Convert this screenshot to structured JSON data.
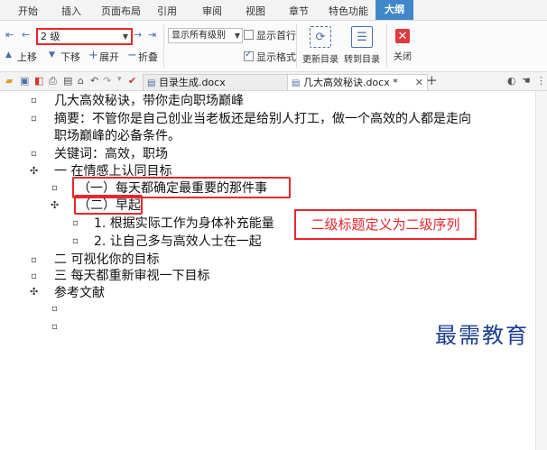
{
  "tabs": [
    "开始",
    "插入",
    "页面布局",
    "引用",
    "审阅",
    "视图",
    "章节",
    "特色功能",
    "大纲"
  ],
  "ribbon": {
    "level_value": "2 级",
    "show_level_value": "显示所有级别",
    "show_first_line_label": "显示首行",
    "show_format_label": "显示格式",
    "move_up_label": "上移",
    "move_down_label": "下移",
    "expand_label": "展开",
    "collapse_label": "折叠",
    "update_toc_label": "更新目录",
    "goto_toc_label": "转到目录",
    "close_label": "关闭"
  },
  "doc_tabs": [
    {
      "label": "目录生成.docx"
    },
    {
      "label": "几大高效秘诀.docx *"
    }
  ],
  "outline": [
    {
      "text": "几大高效秘诀，带你走向职场巅峰"
    },
    {
      "text": "摘要：不管你是自己创业当老板还是给别人打工，做一个高效的人都是走向"
    },
    {
      "text": "职场巅峰的必备条件。"
    },
    {
      "text": "关键词：高效，职场"
    },
    {
      "text": "一  在情感上认同目标"
    },
    {
      "text": "（一）每天都确定最重要的那件事"
    },
    {
      "text": "（二）早起"
    },
    {
      "text": "1. 根据实际工作为身体补充能量"
    },
    {
      "text": "2. 让自己多与高效人士在一起"
    },
    {
      "text": "二  可视化你的目标"
    },
    {
      "text": "三  每天都重新审视一下目标"
    },
    {
      "text": "参考文献"
    }
  ],
  "annotation": "二级标题定义为二级序列",
  "watermark": "最需教育",
  "colors": {
    "accent": "#3f87c9",
    "highlight_red": "#e8262b"
  }
}
